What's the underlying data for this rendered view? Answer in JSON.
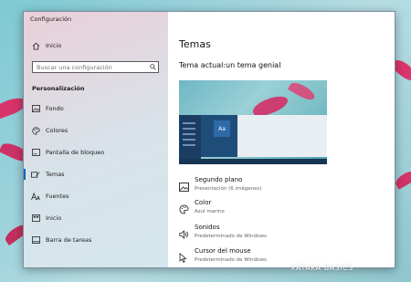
{
  "window": {
    "title": "Configuración"
  },
  "sidebar": {
    "home_label": "Inicio",
    "search_placeholder": "Buscar una configuración",
    "section_title": "Personalización",
    "items": [
      {
        "label": "Fondo",
        "icon": "picture-icon"
      },
      {
        "label": "Colores",
        "icon": "palette-icon"
      },
      {
        "label": "Pantalla de bloqueo",
        "icon": "lock-screen-icon"
      },
      {
        "label": "Temas",
        "icon": "themes-icon",
        "active": true
      },
      {
        "label": "Fuentes",
        "icon": "fonts-icon"
      },
      {
        "label": "Inicio",
        "icon": "start-icon"
      },
      {
        "label": "Barra de tareas",
        "icon": "taskbar-icon"
      }
    ]
  },
  "main": {
    "page_title": "Temas",
    "current_theme": "Tema actual:un tema genial",
    "preview_tile_text": "Aa",
    "settings": [
      {
        "label": "Segundo plano",
        "value": "Presentación (6 imágenes)",
        "icon": "picture-icon"
      },
      {
        "label": "Color",
        "value": "Azul marino",
        "icon": "palette-icon"
      },
      {
        "label": "Sonidos",
        "value": "Predeterminado de Windows",
        "icon": "speaker-icon"
      },
      {
        "label": "Cursor del mouse",
        "value": "Predeterminado de Windows",
        "icon": "cursor-icon"
      }
    ]
  },
  "watermark": "XATAKA BASICS",
  "colors": {
    "accent": "#0067c0"
  }
}
